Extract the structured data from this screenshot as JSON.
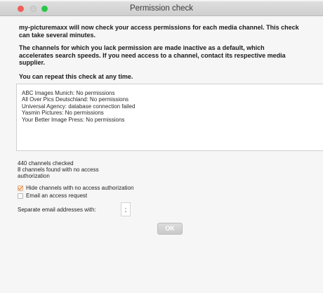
{
  "window": {
    "title": "Permission check"
  },
  "intro": {
    "paragraph1": "my-picturemaxx will now check your access permissions for each media channel. This check\ncan take several minutes.",
    "paragraph2": "The channels for which you lack permission are made inactive as a default, which\naccelerates search speeds. If you need access to a channel, contact its respective media\nsupplier.",
    "paragraph3": "You can repeat this check at any time."
  },
  "results": [
    "ABC Images Munich: No permissions",
    "All Over Pics Deutschland: No permissions",
    "Universal Agency: database connection failed",
    "Yasmin Pictures: No permissions",
    "Your Better Image Press: No permissions"
  ],
  "stats": {
    "checked": "440 channels checked",
    "no_access": "8 channels found with no access\nauthorization"
  },
  "options": {
    "hide_channels": {
      "label": "Hide channels with no access authorization",
      "checked": true
    },
    "email_request": {
      "label": "Email an access request",
      "checked": false
    }
  },
  "separator": {
    "label": "Separate email addresses with:",
    "value": ";"
  },
  "ok_button": "OK",
  "colors": {
    "close": "#f05e57",
    "minimize": "#d0d0d0",
    "maximize": "#2ac64a",
    "check_accent": "#e57a2c"
  }
}
